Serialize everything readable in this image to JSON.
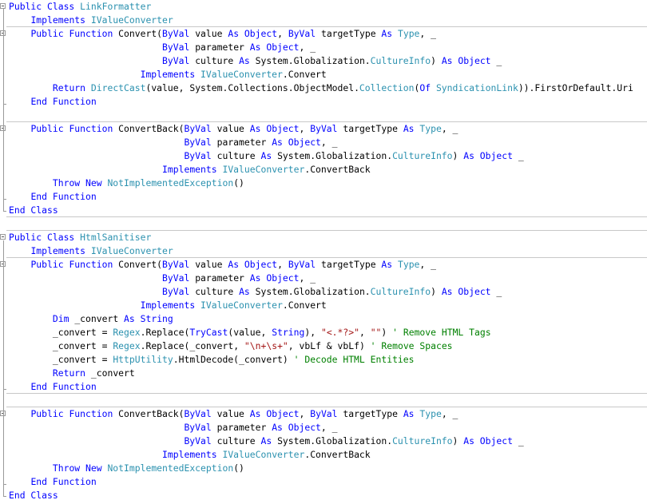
{
  "colors": {
    "keyword": "#0000ff",
    "type": "#2b91af",
    "string": "#a31515",
    "comment": "#008000",
    "plain": "#000000",
    "separator": "#c8c8c8"
  },
  "lines": [
    [
      [
        "kw",
        "Public Class "
      ],
      [
        "ty",
        "LinkFormatter"
      ]
    ],
    [
      [
        "pl",
        "    "
      ],
      [
        "kw",
        "Implements "
      ],
      [
        "ty",
        "IValueConverter"
      ]
    ],
    [
      [
        "pl",
        "    "
      ],
      [
        "kw",
        "Public Function "
      ],
      [
        "pl",
        "Convert("
      ],
      [
        "kw",
        "ByVal "
      ],
      [
        "pl",
        "value "
      ],
      [
        "kw",
        "As Object"
      ],
      [
        "pl",
        ", "
      ],
      [
        "kw",
        "ByVal "
      ],
      [
        "pl",
        "targetType "
      ],
      [
        "kw",
        "As "
      ],
      [
        "ty",
        "Type"
      ],
      [
        "pl",
        ", _"
      ]
    ],
    [
      [
        "pl",
        "                            "
      ],
      [
        "kw",
        "ByVal "
      ],
      [
        "pl",
        "parameter "
      ],
      [
        "kw",
        "As Object"
      ],
      [
        "pl",
        ", _"
      ]
    ],
    [
      [
        "pl",
        "                            "
      ],
      [
        "kw",
        "ByVal "
      ],
      [
        "pl",
        "culture "
      ],
      [
        "kw",
        "As "
      ],
      [
        "pl",
        "System.Globalization."
      ],
      [
        "ty",
        "CultureInfo"
      ],
      [
        "pl",
        ") "
      ],
      [
        "kw",
        "As Object "
      ],
      [
        "pl",
        "_"
      ]
    ],
    [
      [
        "pl",
        "                        "
      ],
      [
        "kw",
        "Implements "
      ],
      [
        "ty",
        "IValueConverter"
      ],
      [
        "pl",
        ".Convert"
      ]
    ],
    [
      [
        "pl",
        "        "
      ],
      [
        "kw",
        "Return "
      ],
      [
        "ty",
        "DirectCast"
      ],
      [
        "pl",
        "(value, System.Collections.ObjectModel."
      ],
      [
        "ty",
        "Collection"
      ],
      [
        "pl",
        "("
      ],
      [
        "kw",
        "Of "
      ],
      [
        "ty",
        "SyndicationLink"
      ],
      [
        "pl",
        ")).FirstOrDefault.Uri"
      ]
    ],
    [
      [
        "pl",
        "    "
      ],
      [
        "kw",
        "End Function"
      ]
    ],
    [],
    [
      [
        "pl",
        "    "
      ],
      [
        "kw",
        "Public Function "
      ],
      [
        "pl",
        "ConvertBack("
      ],
      [
        "kw",
        "ByVal "
      ],
      [
        "pl",
        "value "
      ],
      [
        "kw",
        "As Object"
      ],
      [
        "pl",
        ", "
      ],
      [
        "kw",
        "ByVal "
      ],
      [
        "pl",
        "targetType "
      ],
      [
        "kw",
        "As "
      ],
      [
        "ty",
        "Type"
      ],
      [
        "pl",
        ", _"
      ]
    ],
    [
      [
        "pl",
        "                                "
      ],
      [
        "kw",
        "ByVal "
      ],
      [
        "pl",
        "parameter "
      ],
      [
        "kw",
        "As Object"
      ],
      [
        "pl",
        ", _"
      ]
    ],
    [
      [
        "pl",
        "                                "
      ],
      [
        "kw",
        "ByVal "
      ],
      [
        "pl",
        "culture "
      ],
      [
        "kw",
        "As "
      ],
      [
        "pl",
        "System.Globalization."
      ],
      [
        "ty",
        "CultureInfo"
      ],
      [
        "pl",
        ") "
      ],
      [
        "kw",
        "As Object "
      ],
      [
        "pl",
        "_"
      ]
    ],
    [
      [
        "pl",
        "                            "
      ],
      [
        "kw",
        "Implements "
      ],
      [
        "ty",
        "IValueConverter"
      ],
      [
        "pl",
        ".ConvertBack"
      ]
    ],
    [
      [
        "pl",
        "        "
      ],
      [
        "kw",
        "Throw New "
      ],
      [
        "ty",
        "NotImplementedException"
      ],
      [
        "pl",
        "()"
      ]
    ],
    [
      [
        "pl",
        "    "
      ],
      [
        "kw",
        "End Function"
      ]
    ],
    [
      [
        "kw",
        "End Class"
      ]
    ],
    [],
    [
      [
        "kw",
        "Public Class "
      ],
      [
        "ty",
        "HtmlSanitiser"
      ]
    ],
    [
      [
        "pl",
        "    "
      ],
      [
        "kw",
        "Implements "
      ],
      [
        "ty",
        "IValueConverter"
      ]
    ],
    [
      [
        "pl",
        "    "
      ],
      [
        "kw",
        "Public Function "
      ],
      [
        "pl",
        "Convert("
      ],
      [
        "kw",
        "ByVal "
      ],
      [
        "pl",
        "value "
      ],
      [
        "kw",
        "As Object"
      ],
      [
        "pl",
        ", "
      ],
      [
        "kw",
        "ByVal "
      ],
      [
        "pl",
        "targetType "
      ],
      [
        "kw",
        "As "
      ],
      [
        "ty",
        "Type"
      ],
      [
        "pl",
        ", _"
      ]
    ],
    [
      [
        "pl",
        "                            "
      ],
      [
        "kw",
        "ByVal "
      ],
      [
        "pl",
        "parameter "
      ],
      [
        "kw",
        "As Object"
      ],
      [
        "pl",
        ", _"
      ]
    ],
    [
      [
        "pl",
        "                            "
      ],
      [
        "kw",
        "ByVal "
      ],
      [
        "pl",
        "culture "
      ],
      [
        "kw",
        "As "
      ],
      [
        "pl",
        "System.Globalization."
      ],
      [
        "ty",
        "CultureInfo"
      ],
      [
        "pl",
        ") "
      ],
      [
        "kw",
        "As Object "
      ],
      [
        "pl",
        "_"
      ]
    ],
    [
      [
        "pl",
        "                        "
      ],
      [
        "kw",
        "Implements "
      ],
      [
        "ty",
        "IValueConverter"
      ],
      [
        "pl",
        ".Convert"
      ]
    ],
    [
      [
        "pl",
        "        "
      ],
      [
        "kw",
        "Dim "
      ],
      [
        "pl",
        "_convert "
      ],
      [
        "kw",
        "As String"
      ]
    ],
    [
      [
        "pl",
        "        _convert = "
      ],
      [
        "ty",
        "Regex"
      ],
      [
        "pl",
        ".Replace("
      ],
      [
        "kw",
        "TryCast"
      ],
      [
        "pl",
        "(value, "
      ],
      [
        "kw",
        "String"
      ],
      [
        "pl",
        "), "
      ],
      [
        "str",
        "\"<.*?>\""
      ],
      [
        "pl",
        ", "
      ],
      [
        "str",
        "\"\""
      ],
      [
        "pl",
        ") "
      ],
      [
        "cm",
        "' Remove HTML Tags"
      ]
    ],
    [
      [
        "pl",
        "        _convert = "
      ],
      [
        "ty",
        "Regex"
      ],
      [
        "pl",
        ".Replace(_convert, "
      ],
      [
        "str",
        "\"\\n+\\s+\""
      ],
      [
        "pl",
        ", vbLf & vbLf) "
      ],
      [
        "cm",
        "' Remove Spaces"
      ]
    ],
    [
      [
        "pl",
        "        _convert = "
      ],
      [
        "ty",
        "HttpUtility"
      ],
      [
        "pl",
        ".HtmlDecode(_convert) "
      ],
      [
        "cm",
        "' Decode HTML Entities"
      ]
    ],
    [
      [
        "pl",
        "        "
      ],
      [
        "kw",
        "Return "
      ],
      [
        "pl",
        "_convert"
      ]
    ],
    [
      [
        "pl",
        "    "
      ],
      [
        "kw",
        "End Function"
      ]
    ],
    [],
    [
      [
        "pl",
        "    "
      ],
      [
        "kw",
        "Public Function "
      ],
      [
        "pl",
        "ConvertBack("
      ],
      [
        "kw",
        "ByVal "
      ],
      [
        "pl",
        "value "
      ],
      [
        "kw",
        "As Object"
      ],
      [
        "pl",
        ", "
      ],
      [
        "kw",
        "ByVal "
      ],
      [
        "pl",
        "targetType "
      ],
      [
        "kw",
        "As "
      ],
      [
        "ty",
        "Type"
      ],
      [
        "pl",
        ", _"
      ]
    ],
    [
      [
        "pl",
        "                                "
      ],
      [
        "kw",
        "ByVal "
      ],
      [
        "pl",
        "parameter "
      ],
      [
        "kw",
        "As Object"
      ],
      [
        "pl",
        ", _"
      ]
    ],
    [
      [
        "pl",
        "                                "
      ],
      [
        "kw",
        "ByVal "
      ],
      [
        "pl",
        "culture "
      ],
      [
        "kw",
        "As "
      ],
      [
        "pl",
        "System.Globalization."
      ],
      [
        "ty",
        "CultureInfo"
      ],
      [
        "pl",
        ") "
      ],
      [
        "kw",
        "As Object "
      ],
      [
        "pl",
        "_"
      ]
    ],
    [
      [
        "pl",
        "                            "
      ],
      [
        "kw",
        "Implements "
      ],
      [
        "ty",
        "IValueConverter"
      ],
      [
        "pl",
        ".ConvertBack"
      ]
    ],
    [
      [
        "pl",
        "        "
      ],
      [
        "kw",
        "Throw New "
      ],
      [
        "ty",
        "NotImplementedException"
      ],
      [
        "pl",
        "()"
      ]
    ],
    [
      [
        "pl",
        "    "
      ],
      [
        "kw",
        "End Function"
      ]
    ],
    [
      [
        "kw",
        "End Class"
      ]
    ]
  ]
}
